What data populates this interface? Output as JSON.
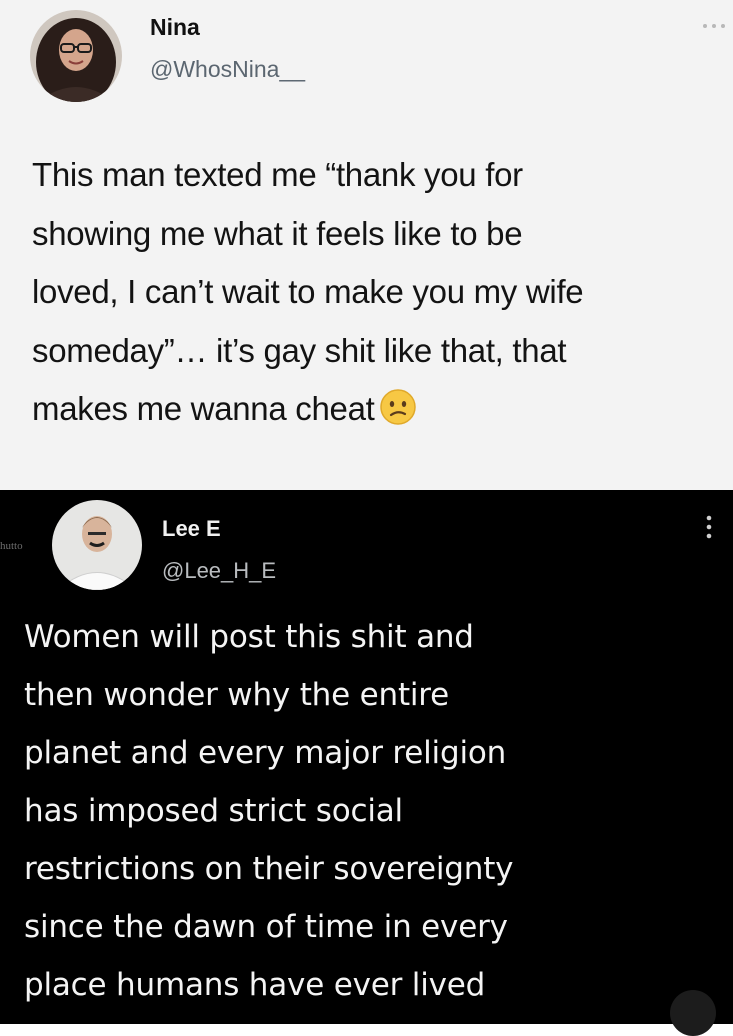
{
  "tweets": [
    {
      "theme": "light",
      "display_name": "Nina",
      "handle": "@WhosNina__",
      "text_lines": [
        "This man texted me “thank you for",
        "showing me what it feels like to be",
        "loved, I can’t wait to make you my wife",
        "someday”… it’s gay shit like that, that",
        "makes me wanna cheat"
      ],
      "trailing_emoji": "confused-face-emoji",
      "avatar_icon": "profile-photo-woman",
      "more_icon": "more-horizontal-icon"
    },
    {
      "theme": "dark",
      "display_name": "Lee E",
      "handle": "@Lee_H_E",
      "avatar_tag_text": "hutto",
      "text_lines": [
        "Women will post this shit and",
        "then wonder why the entire",
        "planet and every major religion",
        "has imposed strict social",
        "restrictions on their sovereignty",
        "since the dawn of time in every",
        "place humans have ever lived"
      ],
      "avatar_icon": "profile-photo-man",
      "more_icon": "more-vertical-icon"
    }
  ],
  "colors": {
    "light_bg": "#f3f3f3",
    "dark_bg": "#000000",
    "handle_light": "#5b6670",
    "handle_dark": "#b9bcbf"
  }
}
